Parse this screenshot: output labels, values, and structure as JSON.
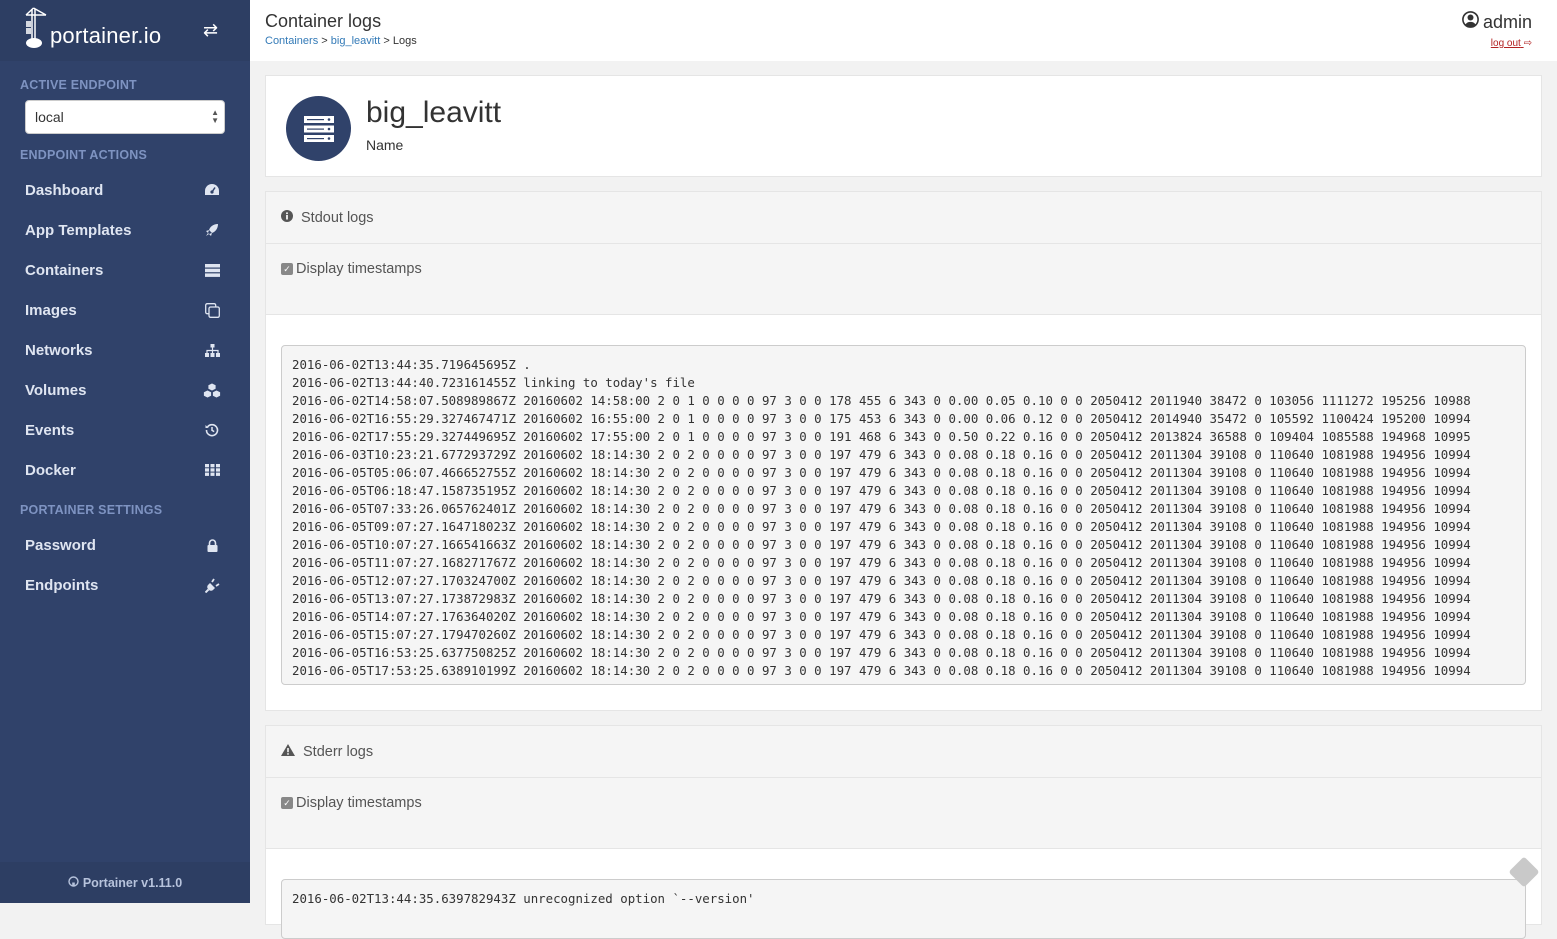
{
  "sidebar": {
    "brand": "portainer.io",
    "active_endpoint_label": "ACTIVE ENDPOINT",
    "endpoint_value": "local",
    "endpoint_actions_label": "ENDPOINT ACTIONS",
    "items": [
      {
        "label": "Dashboard",
        "icon": "tachometer-icon"
      },
      {
        "label": "App Templates",
        "icon": "rocket-icon"
      },
      {
        "label": "Containers",
        "icon": "server-icon"
      },
      {
        "label": "Images",
        "icon": "clone-icon"
      },
      {
        "label": "Networks",
        "icon": "sitemap-icon"
      },
      {
        "label": "Volumes",
        "icon": "cubes-icon"
      },
      {
        "label": "Events",
        "icon": "history-icon"
      },
      {
        "label": "Docker",
        "icon": "th-icon"
      }
    ],
    "settings_label": "PORTAINER SETTINGS",
    "settings_items": [
      {
        "label": "Password",
        "icon": "lock-icon"
      },
      {
        "label": "Endpoints",
        "icon": "plug-icon"
      }
    ],
    "footer": "Portainer v1.11.0"
  },
  "header": {
    "title": "Container logs",
    "breadcrumb": {
      "containers": "Containers",
      "container": "big_leavitt",
      "sep": ">",
      "current": "Logs"
    },
    "user": "admin",
    "logout": "log out"
  },
  "container": {
    "name": "big_leavitt",
    "name_label": "Name"
  },
  "stdout": {
    "title": "Stdout logs",
    "timestamps_label": "Display timestamps",
    "timestamps_checked": true,
    "lines": [
      "2016-06-02T13:44:35.719645695Z .",
      "2016-06-02T13:44:40.723161455Z linking to today's file",
      "2016-06-02T14:58:07.508989867Z 20160602 14:58:00 2 0 1 0 0 0 0 97 3 0 0 178 455 6 343 0 0.00 0.05 0.10 0 0 2050412 2011940 38472 0 103056 1111272 195256 10988",
      "2016-06-02T16:55:29.327467471Z 20160602 16:55:00 2 0 1 0 0 0 0 97 3 0 0 175 453 6 343 0 0.00 0.06 0.12 0 0 2050412 2014940 35472 0 105592 1100424 195200 10994",
      "2016-06-02T17:55:29.327449695Z 20160602 17:55:00 2 0 1 0 0 0 0 97 3 0 0 191 468 6 343 0 0.50 0.22 0.16 0 0 2050412 2013824 36588 0 109404 1085588 194968 10995",
      "2016-06-03T10:23:21.677293729Z 20160602 18:14:30 2 0 2 0 0 0 0 97 3 0 0 197 479 6 343 0 0.08 0.18 0.16 0 0 2050412 2011304 39108 0 110640 1081988 194956 10994",
      "2016-06-05T05:06:07.466652755Z 20160602 18:14:30 2 0 2 0 0 0 0 97 3 0 0 197 479 6 343 0 0.08 0.18 0.16 0 0 2050412 2011304 39108 0 110640 1081988 194956 10994",
      "2016-06-05T06:18:47.158735195Z 20160602 18:14:30 2 0 2 0 0 0 0 97 3 0 0 197 479 6 343 0 0.08 0.18 0.16 0 0 2050412 2011304 39108 0 110640 1081988 194956 10994",
      "2016-06-05T07:33:26.065762401Z 20160602 18:14:30 2 0 2 0 0 0 0 97 3 0 0 197 479 6 343 0 0.08 0.18 0.16 0 0 2050412 2011304 39108 0 110640 1081988 194956 10994",
      "2016-06-05T09:07:27.164718023Z 20160602 18:14:30 2 0 2 0 0 0 0 97 3 0 0 197 479 6 343 0 0.08 0.18 0.16 0 0 2050412 2011304 39108 0 110640 1081988 194956 10994",
      "2016-06-05T10:07:27.166541663Z 20160602 18:14:30 2 0 2 0 0 0 0 97 3 0 0 197 479 6 343 0 0.08 0.18 0.16 0 0 2050412 2011304 39108 0 110640 1081988 194956 10994",
      "2016-06-05T11:07:27.168271767Z 20160602 18:14:30 2 0 2 0 0 0 0 97 3 0 0 197 479 6 343 0 0.08 0.18 0.16 0 0 2050412 2011304 39108 0 110640 1081988 194956 10994",
      "2016-06-05T12:07:27.170324700Z 20160602 18:14:30 2 0 2 0 0 0 0 97 3 0 0 197 479 6 343 0 0.08 0.18 0.16 0 0 2050412 2011304 39108 0 110640 1081988 194956 10994",
      "2016-06-05T13:07:27.173872983Z 20160602 18:14:30 2 0 2 0 0 0 0 97 3 0 0 197 479 6 343 0 0.08 0.18 0.16 0 0 2050412 2011304 39108 0 110640 1081988 194956 10994",
      "2016-06-05T14:07:27.176364020Z 20160602 18:14:30 2 0 2 0 0 0 0 97 3 0 0 197 479 6 343 0 0.08 0.18 0.16 0 0 2050412 2011304 39108 0 110640 1081988 194956 10994",
      "2016-06-05T15:07:27.179470260Z 20160602 18:14:30 2 0 2 0 0 0 0 97 3 0 0 197 479 6 343 0 0.08 0.18 0.16 0 0 2050412 2011304 39108 0 110640 1081988 194956 10994",
      "2016-06-05T16:53:25.637750825Z 20160602 18:14:30 2 0 2 0 0 0 0 97 3 0 0 197 479 6 343 0 0.08 0.18 0.16 0 0 2050412 2011304 39108 0 110640 1081988 194956 10994",
      "2016-06-05T17:53:25.638910199Z 20160602 18:14:30 2 0 2 0 0 0 0 97 3 0 0 197 479 6 343 0 0.08 0.18 0.16 0 0 2050412 2011304 39108 0 110640 1081988 194956 10994"
    ]
  },
  "stderr": {
    "title": "Stderr logs",
    "timestamps_label": "Display timestamps",
    "timestamps_checked": true,
    "lines": [
      "2016-06-02T13:44:35.639782943Z unrecognized option `--version'"
    ]
  },
  "colors": {
    "sidebar_bg": "#30426a",
    "link": "#337ab7",
    "logout": "#b22222"
  }
}
